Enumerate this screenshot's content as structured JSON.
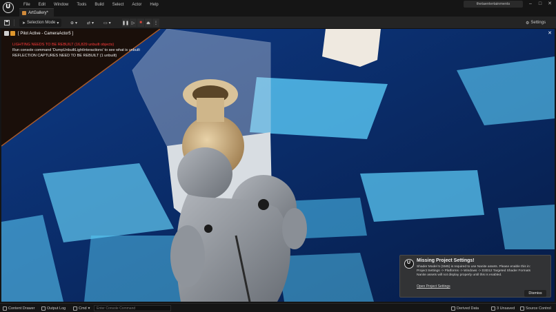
{
  "menu": [
    "File",
    "Edit",
    "Window",
    "Tools",
    "Build",
    "Select",
    "Actor",
    "Help"
  ],
  "tab": {
    "label": "ArtGallery*"
  },
  "project": "thetaentertainments",
  "toolbar": {
    "selection_mode": "Selection Mode",
    "settings": "Settings"
  },
  "viewport": {
    "title": "[ Pilot Active - CameraActor5 ]",
    "warning_red": "LIGHTING NEEDS TO BE REBUILT (16,829 unbuilt objects)",
    "warning_cmd": "Run console command 'DumpUnbuiltLightInteractions' to see what is unbuilt",
    "warning_reflect": "REFLECTION CAPTURES NEED TO BE REBUILT (1 unbuilt)"
  },
  "notification": {
    "title": "Missing Project Settings!",
    "line1": "Shader Model 5 (SM5) is required to use Nanite assets. Please enable this in:",
    "line2": "Project Settings -> Platforms -> Windows -> D3D12 Targeted Shader Formats",
    "line3": "Nanite assets will not display properly until this is enabled.",
    "link": "Open Project Settings",
    "dismiss": "Dismiss"
  },
  "statusbar": {
    "content_drawer": "Content Drawer",
    "output_log": "Output Log",
    "cmd": "Cmd",
    "cmd_placeholder": "Enter Console Command",
    "derived_data": "Derived Data",
    "unsaved": "3 Unsaved",
    "source_control": "Source Control"
  },
  "colors": {
    "accent_red": "#ff3a3a",
    "stop_red": "#e0443a",
    "floor_blue": "#0a2a63",
    "cyan": "#5fd3ff"
  }
}
